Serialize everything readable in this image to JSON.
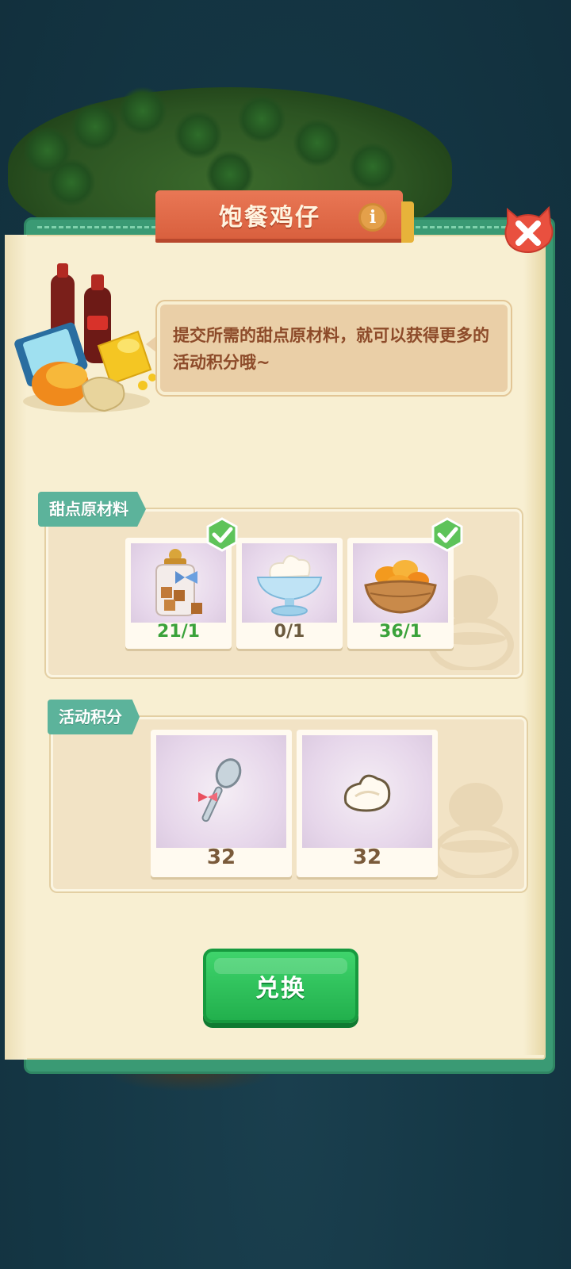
{
  "title": "饱餐鸡仔",
  "info_icon": "info-icon",
  "close_icon": "close-icon",
  "tip_text": "提交所需的甜点原材料，就可以获得更多的活动积分哦~",
  "materials": {
    "label": "甜点原材料",
    "items": [
      {
        "icon": "caramel-jar-icon",
        "count": "21/1",
        "checked": true,
        "count_color": "#3aa23a"
      },
      {
        "icon": "whipped-cream-icon",
        "count": "0/1",
        "checked": false,
        "count_color": "#6b5a3e"
      },
      {
        "icon": "mango-basket-icon",
        "count": "36/1",
        "checked": true,
        "count_color": "#3aa23a"
      }
    ]
  },
  "points": {
    "label": "活动积分",
    "items": [
      {
        "icon": "spoon-icon",
        "count": "32"
      },
      {
        "icon": "cream-dollop-icon",
        "count": "32"
      }
    ]
  },
  "exchange_button": "兑换",
  "colors": {
    "accent_green": "#22b04d",
    "title_red": "#d9603e",
    "label_teal": "#5cb39b",
    "page": "#f8efd2"
  }
}
